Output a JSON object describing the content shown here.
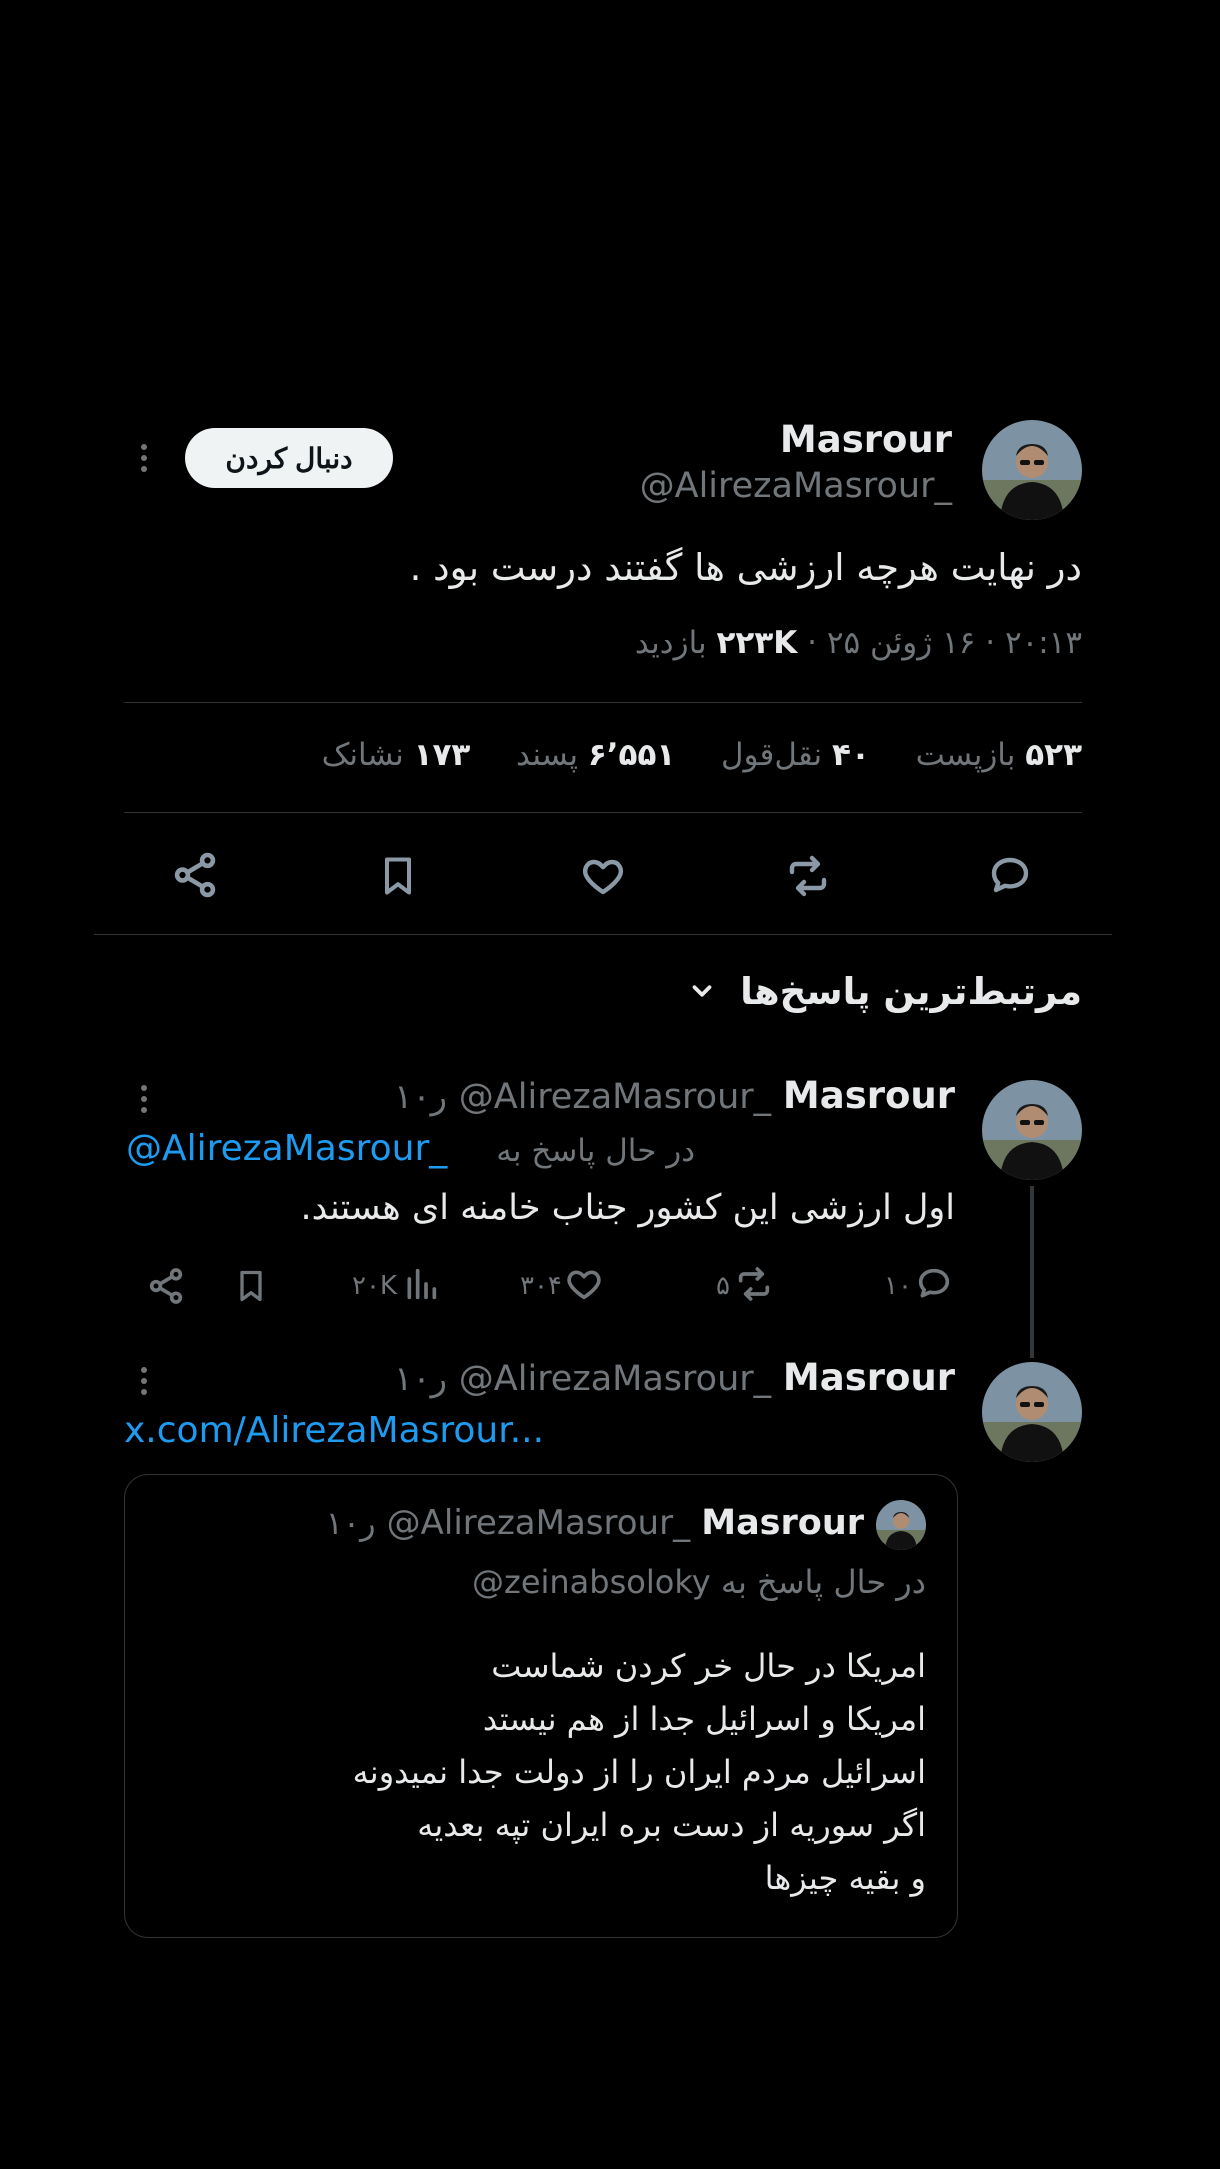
{
  "post": {
    "name": "Masrour",
    "handle": "@AlirezaMasrour_",
    "follow_label": "دنبال کردن",
    "text": "در نهایت هرچه ارزشی ها گفتند درست بود .",
    "time": "۲۰:۱۳",
    "date": "۱۶ ژوئن ۲۵",
    "views_count": "۲۲۳K",
    "views_label": "بازدید",
    "stats": {
      "reposts_count": "۵۲۳",
      "reposts_label": "بازپست",
      "quotes_count": "۴۰",
      "quotes_label": "نقل‌قول",
      "likes_count": "۶٬۵۵۱",
      "likes_label": "پسند",
      "bookmarks_count": "۱۷۳",
      "bookmarks_label": "نشانک"
    }
  },
  "replies_header": "مرتبط‌ترین پاسخ‌ها",
  "reply1": {
    "name": "Masrour",
    "handle": "@AlirezaMasrour_",
    "age": "۱۰ر",
    "replying_to_prefix": "در حال پاسخ به",
    "replying_to_handle": "@AlirezaMasrour_",
    "text": "اول ارزشی این کشور جناب خامنه ای هستند.",
    "reply_count": "۱۰",
    "repost_count": "۵",
    "like_count": "۳۰۴",
    "views_count": "۲۰K"
  },
  "reply2": {
    "name": "Masrour",
    "handle": "@AlirezaMasrour_",
    "age": "۱۰ر",
    "link_text": "x.com/AlirezaMasrour...",
    "quote": {
      "name": "Masrour",
      "handle": "@AlirezaMasrour_",
      "age": "۱۰ر",
      "replying_to_prefix": "در حال پاسخ به",
      "replying_to_handle": "@zeinabsoloky",
      "lines": [
        "امریکا در حال خر کردن شماست",
        "امریکا و اسرائیل جدا از هم نیستد",
        "اسرائیل مردم ایران را از دولت جدا نمیدونه",
        "اگر سوریه از دست بره ایران تپه بعدیه",
        "و بقیه چیزها"
      ]
    }
  },
  "colors": {
    "background": "#000000",
    "text": "#e7e9ea",
    "muted": "#71767b",
    "link": "#1d9bf0",
    "border": "#2f3336"
  },
  "icons": [
    "more-icon",
    "reply-icon",
    "repost-icon",
    "like-icon",
    "bookmark-icon",
    "share-icon",
    "chevron-down-icon",
    "views-icon"
  ]
}
